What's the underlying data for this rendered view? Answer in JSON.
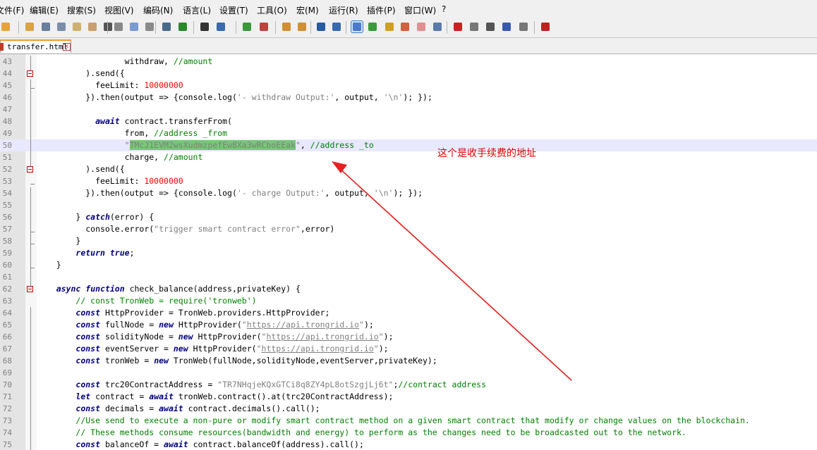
{
  "menu": [
    "文件(F)",
    "编辑(E)",
    "搜索(S)",
    "视图(V)",
    "编码(N)",
    "语言(L)",
    "设置(T)",
    "工具(O)",
    "宏(M)",
    "运行(R)",
    "插件(P)",
    "窗口(W)",
    "?"
  ],
  "tab": {
    "label": "transfer.html",
    "close": "x"
  },
  "toolbar_icons": [
    "new-icon",
    "open-icon",
    "save-icon",
    "save-all-icon",
    "close-icon",
    "close-all-icon",
    "print-icon",
    "cut-icon",
    "copy-icon",
    "paste-icon",
    "undo-icon",
    "redo-icon",
    "find-icon",
    "replace-icon",
    "zoom-in-icon",
    "zoom-out-icon",
    "sync-v-icon",
    "sync-h-icon",
    "word-wrap-icon",
    "all-chars-icon",
    "indent-guide-icon",
    "lang-icon",
    "doc-map-icon",
    "func-list-icon",
    "folder-icon",
    "monitor-icon",
    "record-icon",
    "stop-icon",
    "play-icon",
    "run-multi-icon",
    "save-macro-icon",
    "spellcheck-icon"
  ],
  "annotation": "这个是收手续费的地址",
  "code_lines": [
    {
      "n": "43",
      "parts": [
        [
          "t",
          "                  withdraw, "
        ],
        [
          "cm",
          "//amount"
        ]
      ]
    },
    {
      "n": "44",
      "parts": [
        [
          "t",
          "          )."
        ],
        [
          "t",
          "send"
        ],
        [
          "t",
          "({"
        ]
      ]
    },
    {
      "n": "45",
      "parts": [
        [
          "t",
          "            feeLimit: "
        ],
        [
          "num",
          "10000000"
        ]
      ]
    },
    {
      "n": "46",
      "parts": [
        [
          "t",
          "          })."
        ],
        [
          "t",
          "then"
        ],
        [
          "t",
          "(output => {console.log("
        ],
        [
          "str",
          "'- withdraw Output:'"
        ],
        [
          "t",
          ", output, "
        ],
        [
          "str",
          "'\\n'"
        ],
        [
          "t",
          "); });"
        ]
      ]
    },
    {
      "n": "47",
      "parts": [
        [
          "t",
          ""
        ]
      ]
    },
    {
      "n": "48",
      "parts": [
        [
          "t",
          "            "
        ],
        [
          "kw",
          "await"
        ],
        [
          "t",
          " contract.transferFrom("
        ]
      ]
    },
    {
      "n": "49",
      "parts": [
        [
          "t",
          "                  from, "
        ],
        [
          "cm",
          "//address _from"
        ]
      ]
    },
    {
      "n": "50",
      "parts": [
        [
          "t",
          "                  "
        ],
        [
          "str",
          "\""
        ],
        [
          "sel",
          "TMcJ1EVM2wsXudmzpefEw8Xa3wRCboEEak"
        ],
        [
          "str",
          "\""
        ],
        [
          "t",
          ", "
        ],
        [
          "cm",
          "//address _to"
        ]
      ]
    },
    {
      "n": "51",
      "parts": [
        [
          "t",
          "                  charge, "
        ],
        [
          "cm",
          "//amount"
        ]
      ]
    },
    {
      "n": "52",
      "parts": [
        [
          "t",
          "          )."
        ],
        [
          "t",
          "send"
        ],
        [
          "t",
          "({"
        ]
      ]
    },
    {
      "n": "53",
      "parts": [
        [
          "t",
          "            feeLimit: "
        ],
        [
          "num",
          "10000000"
        ]
      ]
    },
    {
      "n": "54",
      "parts": [
        [
          "t",
          "          })."
        ],
        [
          "t",
          "then"
        ],
        [
          "t",
          "(output => {console.log("
        ],
        [
          "str",
          "'- charge Output:'"
        ],
        [
          "t",
          ", output, "
        ],
        [
          "str",
          "'\\n'"
        ],
        [
          "t",
          "); });"
        ]
      ]
    },
    {
      "n": "55",
      "parts": [
        [
          "t",
          ""
        ]
      ]
    },
    {
      "n": "56",
      "parts": [
        [
          "t",
          "        } "
        ],
        [
          "kw",
          "catch"
        ],
        [
          "t",
          "(error) {"
        ]
      ]
    },
    {
      "n": "57",
      "parts": [
        [
          "t",
          "          console.error("
        ],
        [
          "str",
          "\"trigger smart contract error\""
        ],
        [
          "t",
          ",error)"
        ]
      ]
    },
    {
      "n": "58",
      "parts": [
        [
          "t",
          "        }"
        ]
      ]
    },
    {
      "n": "59",
      "parts": [
        [
          "t",
          "        "
        ],
        [
          "kw",
          "return"
        ],
        [
          "t",
          " "
        ],
        [
          "kw",
          "true"
        ],
        [
          "t",
          ";"
        ]
      ]
    },
    {
      "n": "60",
      "parts": [
        [
          "t",
          "    }"
        ]
      ]
    },
    {
      "n": "61",
      "parts": [
        [
          "t",
          ""
        ]
      ]
    },
    {
      "n": "62",
      "parts": [
        [
          "t",
          "    "
        ],
        [
          "kw",
          "async"
        ],
        [
          "t",
          " "
        ],
        [
          "kw",
          "function"
        ],
        [
          "t",
          " check_balance(address,privateKey) {"
        ]
      ]
    },
    {
      "n": "63",
      "parts": [
        [
          "t",
          "        "
        ],
        [
          "cm",
          "// const TronWeb = require('tronweb')"
        ]
      ]
    },
    {
      "n": "64",
      "parts": [
        [
          "t",
          "        "
        ],
        [
          "kw",
          "const"
        ],
        [
          "t",
          " HttpProvider = TronWeb.providers.HttpProvider;"
        ]
      ]
    },
    {
      "n": "65",
      "parts": [
        [
          "t",
          "        "
        ],
        [
          "kw",
          "const"
        ],
        [
          "t",
          " fullNode = "
        ],
        [
          "kw",
          "new"
        ],
        [
          "t",
          " HttpProvider("
        ],
        [
          "str",
          "\""
        ],
        [
          "url",
          "https://api.trongrid.io"
        ],
        [
          "str",
          "\""
        ],
        [
          "t",
          ");"
        ]
      ]
    },
    {
      "n": "66",
      "parts": [
        [
          "t",
          "        "
        ],
        [
          "kw",
          "const"
        ],
        [
          "t",
          " solidityNode = "
        ],
        [
          "kw",
          "new"
        ],
        [
          "t",
          " HttpProvider("
        ],
        [
          "str",
          "\""
        ],
        [
          "url",
          "https://api.trongrid.io"
        ],
        [
          "str",
          "\""
        ],
        [
          "t",
          ");"
        ]
      ]
    },
    {
      "n": "67",
      "parts": [
        [
          "t",
          "        "
        ],
        [
          "kw",
          "const"
        ],
        [
          "t",
          " eventServer = "
        ],
        [
          "kw",
          "new"
        ],
        [
          "t",
          " HttpProvider("
        ],
        [
          "str",
          "\""
        ],
        [
          "url",
          "https://api.trongrid.io"
        ],
        [
          "str",
          "\""
        ],
        [
          "t",
          ");"
        ]
      ]
    },
    {
      "n": "68",
      "parts": [
        [
          "t",
          "        "
        ],
        [
          "kw",
          "const"
        ],
        [
          "t",
          " tronWeb = "
        ],
        [
          "kw",
          "new"
        ],
        [
          "t",
          " TronWeb(fullNode,solidityNode,eventServer,privateKey);"
        ]
      ]
    },
    {
      "n": "69",
      "parts": [
        [
          "t",
          ""
        ]
      ]
    },
    {
      "n": "70",
      "parts": [
        [
          "t",
          "        "
        ],
        [
          "kw",
          "const"
        ],
        [
          "t",
          " trc20ContractAddress = "
        ],
        [
          "str",
          "\"TR7NHqjeKQxGTCi8q8ZY4pL8otSzgjLj6t\""
        ],
        [
          "t",
          ";"
        ],
        [
          "cm",
          "//contract address"
        ]
      ]
    },
    {
      "n": "71",
      "parts": [
        [
          "t",
          "        "
        ],
        [
          "kw",
          "let"
        ],
        [
          "t",
          " contract = "
        ],
        [
          "kw",
          "await"
        ],
        [
          "t",
          " tronWeb.contract().at(trc20ContractAddress);"
        ]
      ]
    },
    {
      "n": "72",
      "parts": [
        [
          "t",
          "        "
        ],
        [
          "kw",
          "const"
        ],
        [
          "t",
          " decimals = "
        ],
        [
          "kw",
          "await"
        ],
        [
          "t",
          " contract.decimals().call();"
        ]
      ]
    },
    {
      "n": "73",
      "parts": [
        [
          "t",
          "        "
        ],
        [
          "cm",
          "//Use send to execute a non-pure or modify smart contract method on a given smart contract that modify or change values on the blockchain."
        ]
      ]
    },
    {
      "n": "74",
      "parts": [
        [
          "t",
          "        "
        ],
        [
          "cm",
          "// These methods consume resources(bandwidth and energy) to perform as the changes need to be broadcasted out to the network."
        ]
      ]
    },
    {
      "n": "75",
      "parts": [
        [
          "t",
          "        "
        ],
        [
          "kw",
          "const"
        ],
        [
          "t",
          " balanceOf = "
        ],
        [
          "kw",
          "await"
        ],
        [
          "t",
          " contract.balanceOf(address).call();"
        ]
      ]
    }
  ]
}
